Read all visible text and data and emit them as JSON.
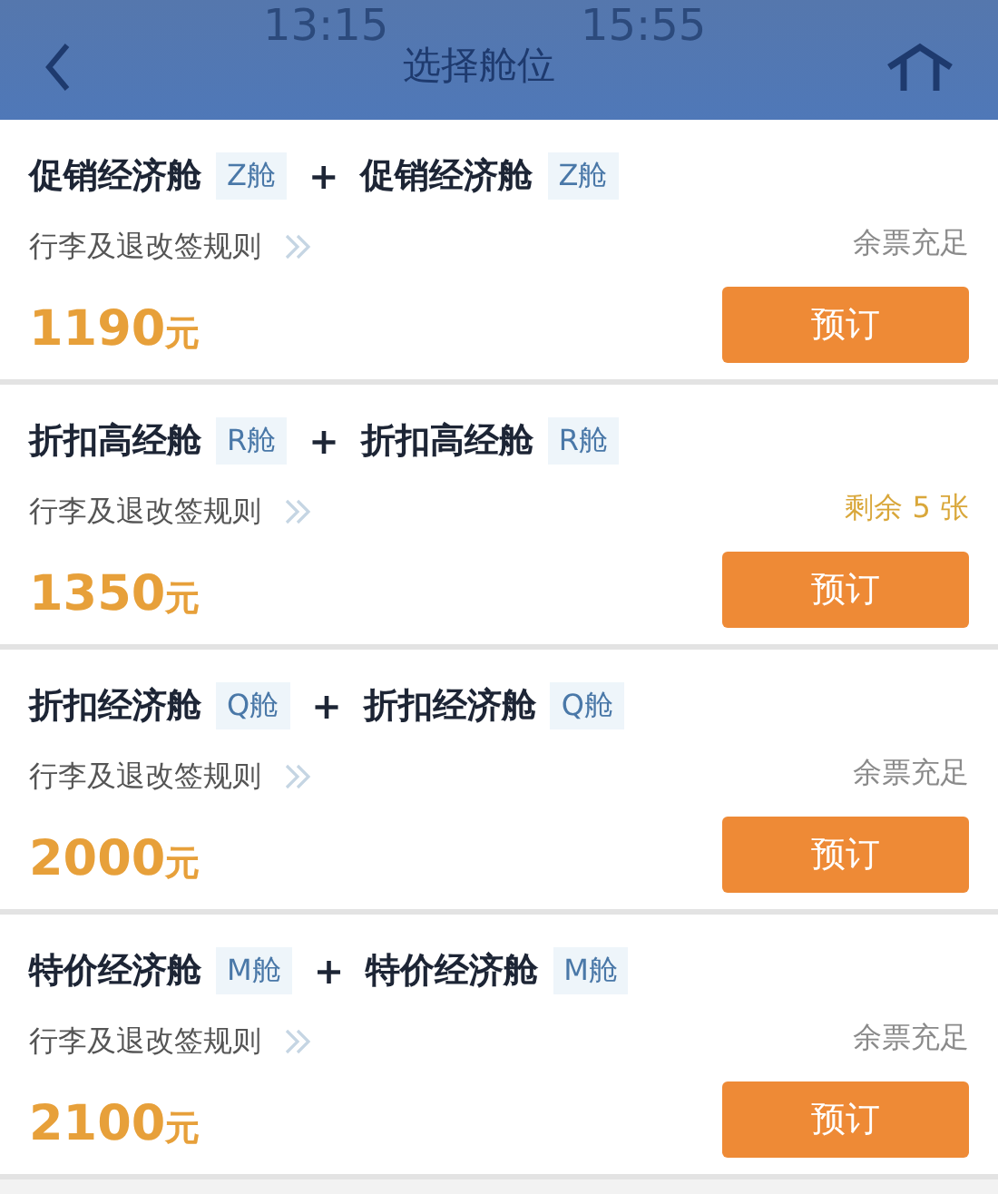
{
  "header": {
    "title": "选择舱位",
    "background_times": [
      "13:15",
      "15:55"
    ]
  },
  "fares": [
    {
      "segments": [
        {
          "name": "促销经济舱",
          "cabin": "Z舱"
        },
        {
          "name": "促销经济舱",
          "cabin": "Z舱"
        }
      ],
      "joiner": "+",
      "rules": "行李及退改签规则",
      "availability": {
        "kind": "plenty",
        "text": "余票充足"
      },
      "price": "1190",
      "unit": "元",
      "button": "预订"
    },
    {
      "segments": [
        {
          "name": "折扣高经舱",
          "cabin": "R舱"
        },
        {
          "name": "折扣高经舱",
          "cabin": "R舱"
        }
      ],
      "joiner": "+",
      "rules": "行李及退改签规则",
      "availability": {
        "kind": "limited",
        "text": "剩余 5 张"
      },
      "price": "1350",
      "unit": "元",
      "button": "预订"
    },
    {
      "segments": [
        {
          "name": "折扣经济舱",
          "cabin": "Q舱"
        },
        {
          "name": "折扣经济舱",
          "cabin": "Q舱"
        }
      ],
      "joiner": "+",
      "rules": "行李及退改签规则",
      "availability": {
        "kind": "plenty",
        "text": "余票充足"
      },
      "price": "2000",
      "unit": "元",
      "button": "预订"
    },
    {
      "segments": [
        {
          "name": "特价经济舱",
          "cabin": "M舱"
        },
        {
          "name": "特价经济舱",
          "cabin": "M舱"
        }
      ],
      "joiner": "+",
      "rules": "行李及退改签规则",
      "availability": {
        "kind": "plenty",
        "text": "余票充足"
      },
      "price": "2100",
      "unit": "元",
      "button": "预订"
    }
  ]
}
